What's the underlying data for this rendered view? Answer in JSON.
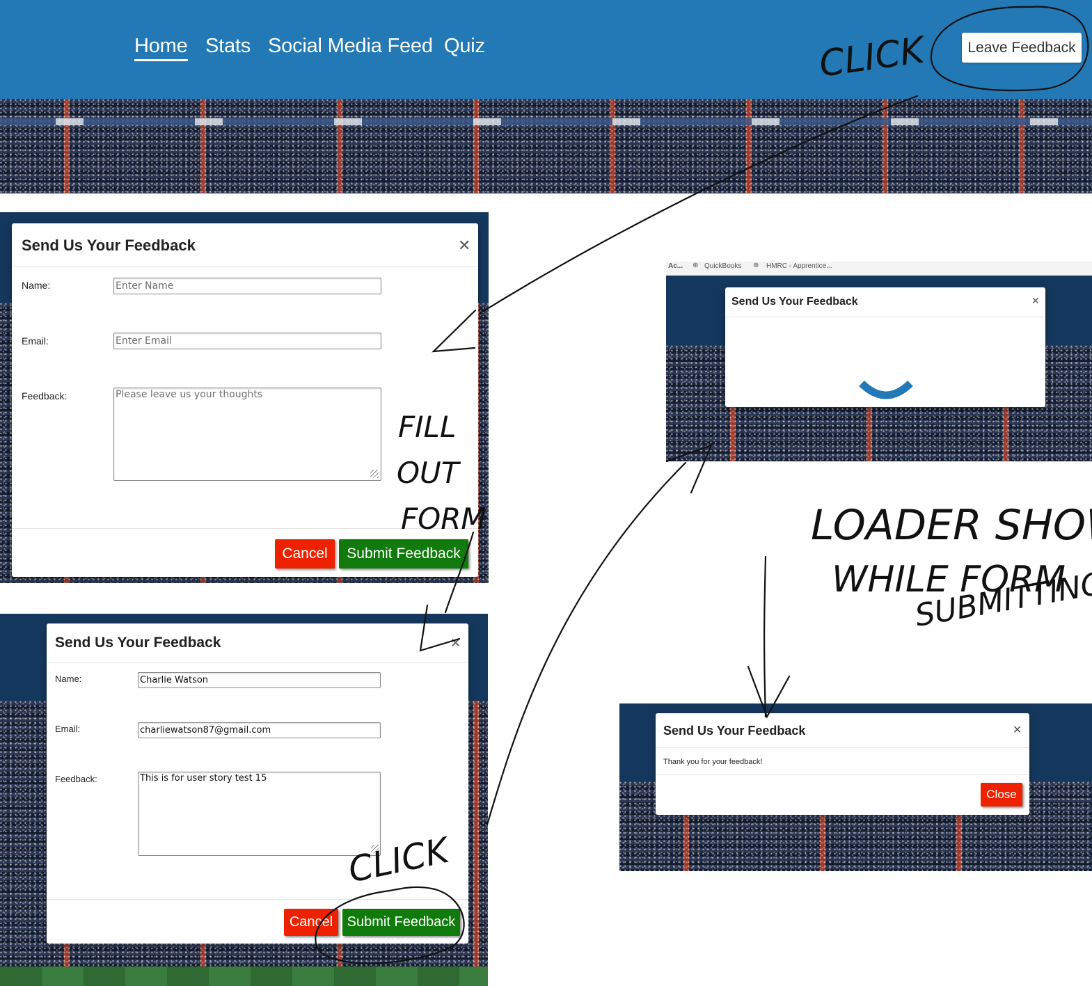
{
  "nav": {
    "links": [
      "Home",
      "Stats",
      "Social Media Feed",
      "Quiz"
    ],
    "leave_feedback": "Leave Feedback"
  },
  "empty_form": {
    "title": "Send Us Your Feedback",
    "name_label": "Name:",
    "email_label": "Email:",
    "feedback_label": "Feedback:",
    "name_placeholder": "Enter Name",
    "email_placeholder": "Enter Email",
    "feedback_placeholder": "Please leave us your thoughts",
    "cancel": "Cancel",
    "submit": "Submit Feedback"
  },
  "filled_form": {
    "title": "Send Us Your Feedback",
    "name_label": "Name:",
    "email_label": "Email:",
    "feedback_label": "Feedback:",
    "name_value": "Charlie Watson",
    "email_value": "charliewatson87@gmail.com",
    "feedback_value": "This is for user story test 15",
    "cancel": "Cancel",
    "submit": "Submit Feedback"
  },
  "loading_modal": {
    "bookmarks": [
      "Ac...",
      "QuickBooks",
      "HMRC - Apprentice..."
    ],
    "title": "Send Us Your Feedback"
  },
  "success_modal": {
    "title": "Send Us Your Feedback",
    "message": "Thank you for your feedback!",
    "close": "Close"
  },
  "annotations": {
    "click_top": "CLICK",
    "fill_out_form": [
      "FILL",
      "OUT",
      "FORM"
    ],
    "loader_note": [
      "LOADER SHOWS",
      "WHILE FORM",
      "SUBMITTING"
    ],
    "click_bottom": "CLICK"
  },
  "colors": {
    "navbar": "#2279b6",
    "cancel_red": "#ee2200",
    "submit_green": "#107a0c",
    "loader_blue": "#2279b6"
  }
}
